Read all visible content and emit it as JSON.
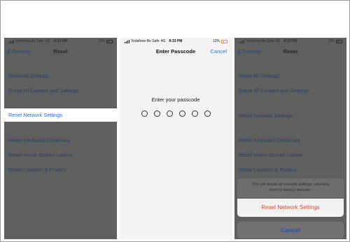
{
  "status": {
    "carrier": "Vodafone-Be Safe",
    "network": "4G",
    "time": "8:33 PM",
    "battery": "12%"
  },
  "panel_left": {
    "back_label": "General",
    "title": "Reset",
    "rows": [
      "Reset All Settings",
      "Erase All Content and Settings",
      "Reset Network Settings",
      "Reset Keyboard Dictionary",
      "Reset Home Screen Layout",
      "Reset Location & Privacy"
    ]
  },
  "panel_passcode": {
    "title": "Enter Passcode",
    "cancel_label": "Cancel",
    "prompt": "Enter your passcode",
    "digits": 6
  },
  "panel_right": {
    "back_label": "General",
    "title": "Reset",
    "rows": [
      "Reset All Settings",
      "Erase All Content and Settings",
      "Reset Network Settings",
      "Reset Keyboard Dictionary",
      "Reset Home Screen Layout",
      "Reset Location & Privacy"
    ],
    "sheet_message": "This will delete all network settings, returning them to factory defaults.",
    "sheet_action": "Reset Network Settings",
    "sheet_cancel": "Cancel"
  },
  "colors": {
    "ios_blue": "#1e74d6",
    "destructive_red": "#e0453c",
    "dimmed_overlay": "#5f5f5f"
  }
}
